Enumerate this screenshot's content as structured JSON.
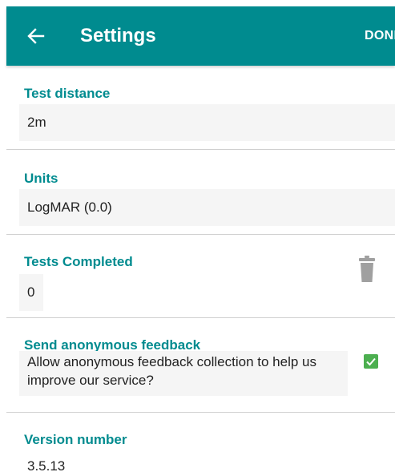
{
  "appbar": {
    "title": "Settings",
    "done_label": "DONE",
    "back_icon": "arrow-left-icon",
    "color": "#008b8f"
  },
  "settings": {
    "test_distance": {
      "label": "Test distance",
      "value": "2m"
    },
    "units": {
      "label": "Units",
      "value": "LogMAR (0.0)"
    },
    "tests_completed": {
      "label": "Tests Completed",
      "value": "0",
      "action_icon": "trash-icon"
    },
    "feedback": {
      "label": "Send anonymous feedback",
      "description": "Allow anonymous feedback collection to help us improve our service?",
      "checked": true,
      "checkbox_color": "#4caf50"
    },
    "version": {
      "label": "Version number",
      "value": "3.5.13"
    }
  },
  "colors": {
    "accent": "#008b8f",
    "field_background": "#f5f5f5",
    "divider": "#d0d0d0"
  }
}
